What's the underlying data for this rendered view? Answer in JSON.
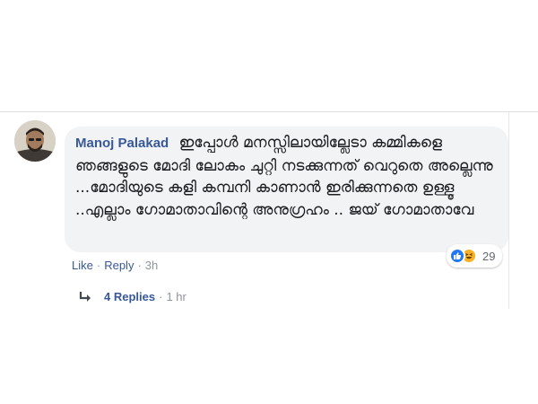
{
  "comment": {
    "author": "Manoj Palakad",
    "text": "ഇപ്പോൾ മനസ്സിലായില്ലേടാ കമ്മികളെ ഞങ്ങളുടെ മോദി ലോകം ചുറ്റി നടക്കുന്നത് വെറുതെ അല്ലെന്നു ...മോദിയുടെ കളി കമ്പനി കാണാൻ ഇരിക്കുന്നതെ ഉള്ളൂ ..എല്ലാം ഗോമാതാവിന്റെ അനുഗ്രഹം .. ജയ് ഗോമാതാവേ"
  },
  "reactions": {
    "icons": [
      "like-icon",
      "haha-icon"
    ],
    "count": "29",
    "colors": {
      "like": "#2078f4",
      "haha": "#f7b125"
    }
  },
  "actions": {
    "like_label": "Like",
    "reply_label": "Reply",
    "timestamp": "3h",
    "separator": "·"
  },
  "replies": {
    "label": "4 Replies",
    "separator": "·",
    "timestamp": "1 hr"
  },
  "colors": {
    "link": "#385898",
    "bubble": "#f2f3f5",
    "meta": "#90949c"
  }
}
